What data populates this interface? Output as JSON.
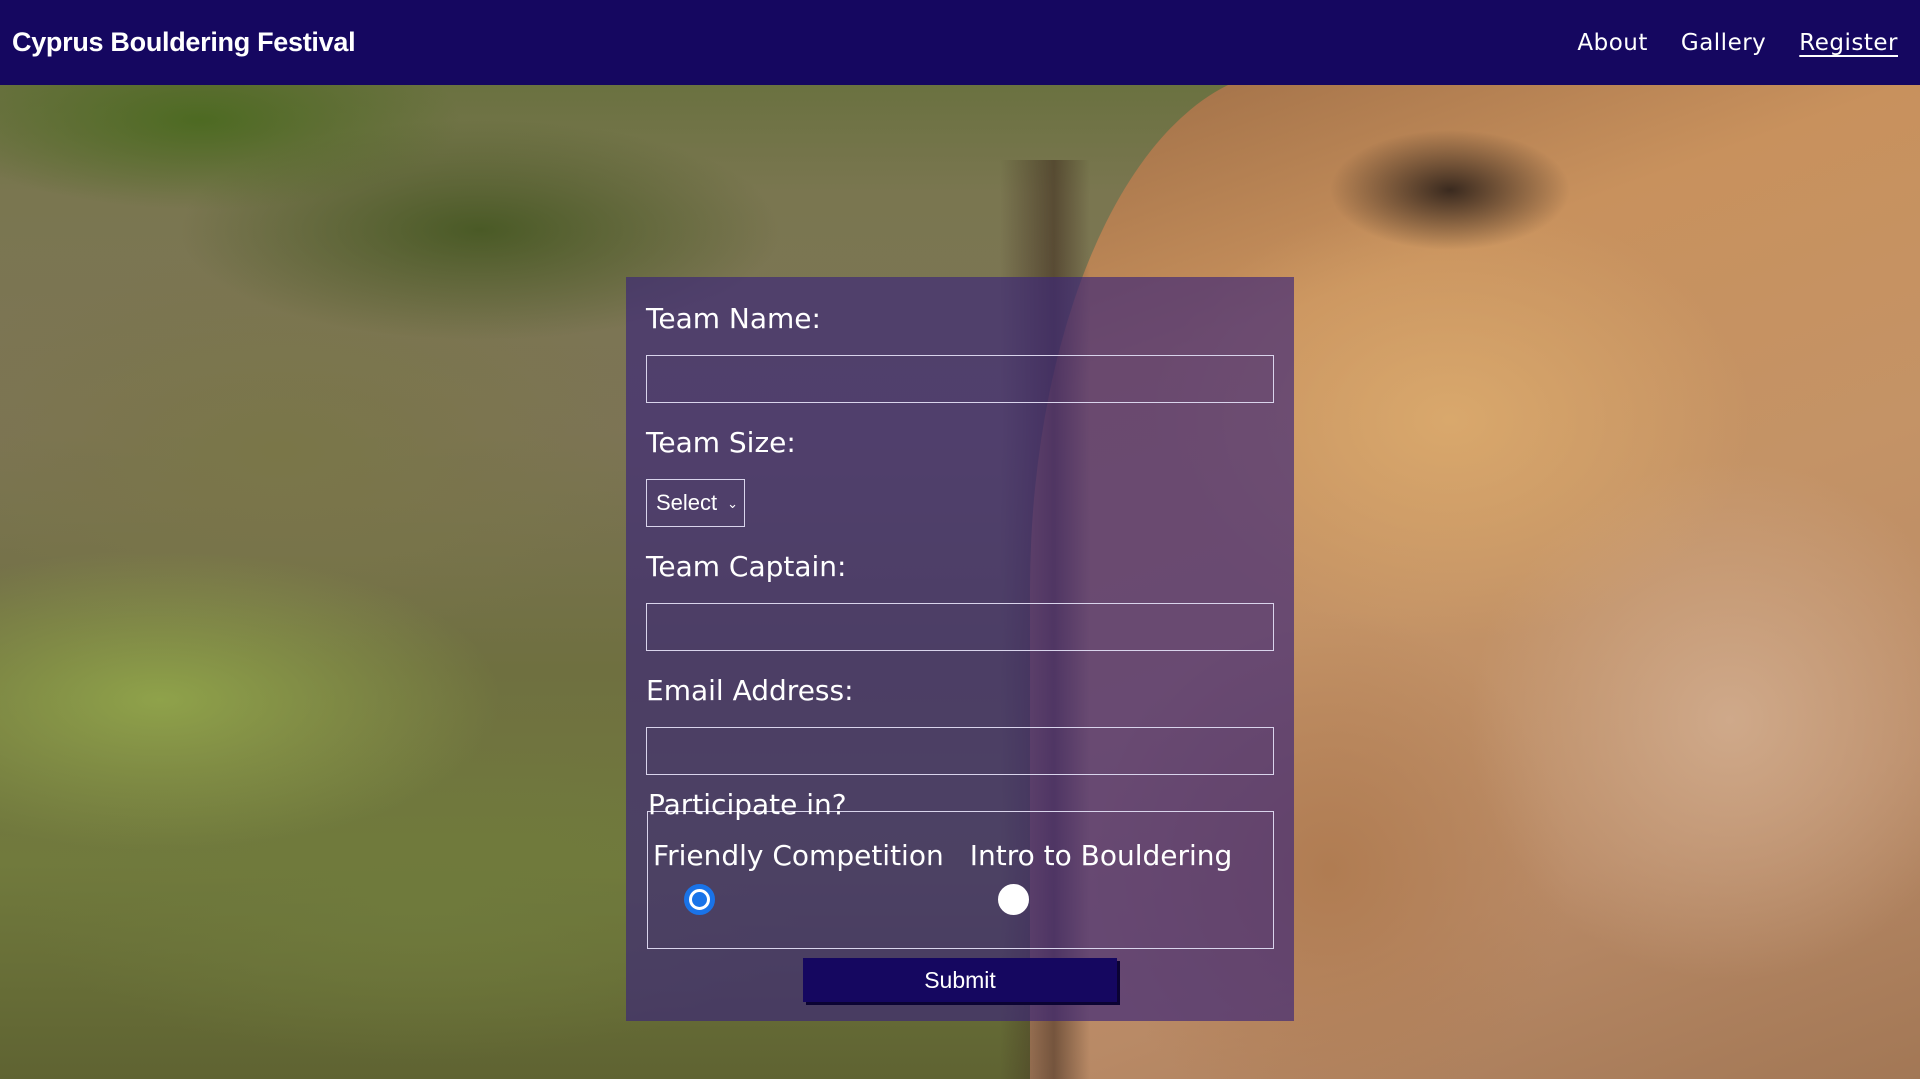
{
  "navbar": {
    "brand": "Cyprus Bouldering Festival",
    "links": [
      {
        "label": "About"
      },
      {
        "label": "Gallery"
      },
      {
        "label": "Register",
        "active": true
      }
    ]
  },
  "form": {
    "team_name_label": "Team Name:",
    "team_name_value": "",
    "team_size_label": "Team Size:",
    "team_size_selected": "Select",
    "team_captain_label": "Team Captain:",
    "team_captain_value": "",
    "email_label": "Email Address:",
    "email_value": "",
    "participate_legend": "Participate in?",
    "options": [
      {
        "label": "Friendly Competition",
        "checked": true
      },
      {
        "label": "Intro to Bouldering",
        "checked": false
      }
    ],
    "submit_label": "Submit"
  },
  "colors": {
    "navbar_bg": "#150760",
    "panel_bg": "#3a2478",
    "radio_accent": "#1a73e8"
  },
  "icons": {
    "select_chevron": "chevron-down-icon"
  }
}
